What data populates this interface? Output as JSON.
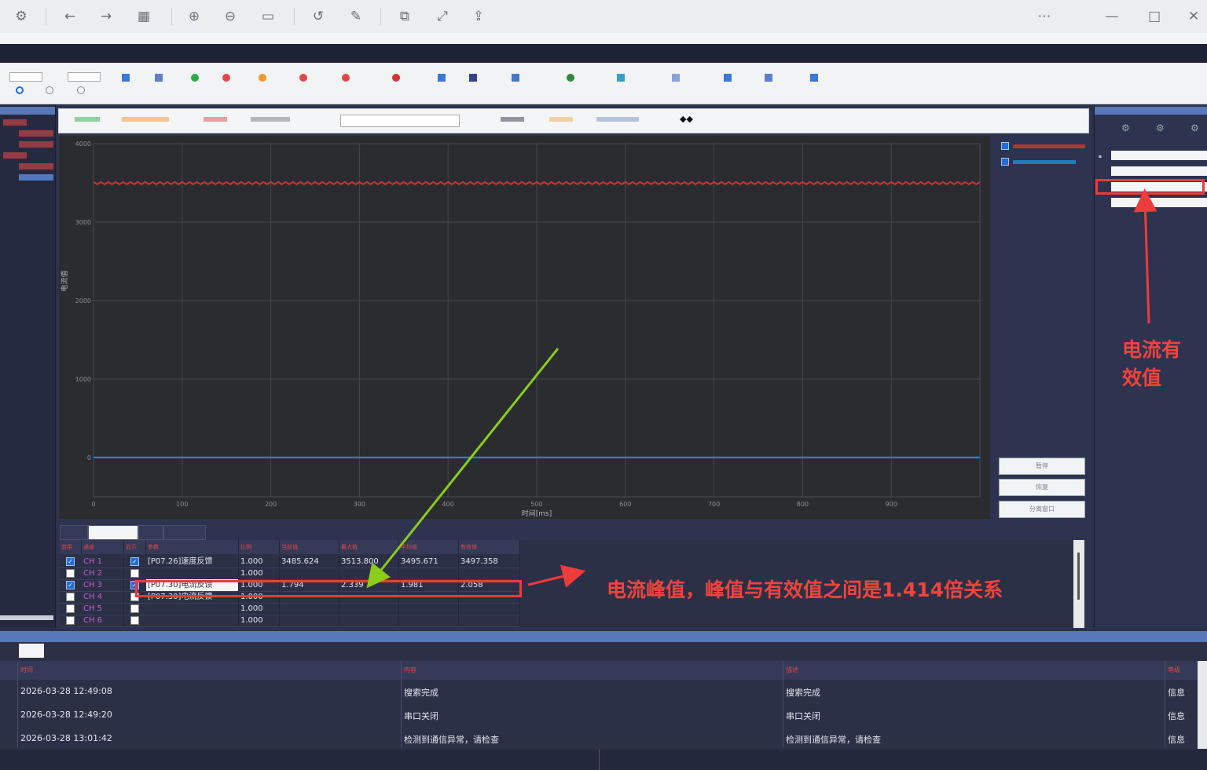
{
  "chart_data": {
    "type": "line",
    "xlabel": "时间[ms]",
    "ylabel": "电流值",
    "x_ticks": [
      "0",
      "100",
      "200",
      "300",
      "400",
      "500",
      "600",
      "700",
      "800",
      "900"
    ],
    "y_ticks": [
      "4000",
      "3000",
      "2000",
      "1000",
      "0"
    ],
    "xlim": [
      0,
      1000
    ],
    "ylim": [
      -500,
      4000
    ],
    "series": [
      {
        "color": "#d23434",
        "x": [
          0,
          1000
        ],
        "y": [
          3497,
          3497
        ]
      },
      {
        "color": "#1f8fd6",
        "x": [
          0,
          1000
        ],
        "y": [
          2,
          2
        ]
      }
    ],
    "grid": true
  },
  "table": {
    "headers": [
      "启用",
      "通道",
      "显示",
      "参数",
      "比例",
      "当前值",
      "最大值",
      "平均值",
      "有效值"
    ],
    "rows": [
      {
        "enable": true,
        "channel": "CH 1",
        "show": true,
        "param": "[P07.26]速度反馈",
        "ratio": "1.000",
        "current": "3485.624",
        "max": "3513.800",
        "avg": "3495.671",
        "rms": "3497.358"
      },
      {
        "enable": false,
        "channel": "CH 2",
        "show": false,
        "param": "",
        "ratio": "1.000",
        "current": "",
        "max": "",
        "avg": "",
        "rms": ""
      },
      {
        "enable": true,
        "channel": "CH 3",
        "show": true,
        "param": "[P07.30]电流反馈",
        "ratio": "1.000",
        "current": "1.794",
        "max": "2.339",
        "avg": "1.981",
        "rms": "2.058"
      },
      {
        "enable": false,
        "channel": "CH 4",
        "show": false,
        "param": "[P07.30]电流反馈",
        "ratio": "1.000",
        "current": "",
        "max": "",
        "avg": "",
        "rms": ""
      },
      {
        "enable": false,
        "channel": "CH 5",
        "show": false,
        "param": "",
        "ratio": "1.000",
        "current": "",
        "max": "",
        "avg": "",
        "rms": ""
      },
      {
        "enable": false,
        "channel": "CH 6",
        "show": false,
        "param": "",
        "ratio": "1.000",
        "current": "",
        "max": "",
        "avg": "",
        "rms": ""
      }
    ]
  },
  "side_buttons": [
    "暂停",
    "恢复",
    "分离窗口"
  ],
  "log": {
    "headers": [
      "时间",
      "内容",
      "描述",
      "等级"
    ],
    "rows": [
      {
        "time": "2026-03-28 12:49:08",
        "content": "搜索完成",
        "desc": "搜索完成",
        "level": "信息"
      },
      {
        "time": "2026-03-28 12:49:20",
        "content": "串口关闭",
        "desc": "串口关闭",
        "level": "信息"
      },
      {
        "time": "2026-03-28 13:01:42",
        "content": "检测到通信异常，请检查",
        "desc": "检测到通信异常，请检查",
        "level": "信息"
      }
    ]
  },
  "annotations": {
    "rms_label_line1": "电流有",
    "rms_label_line2": "效值",
    "peak_label": "电流峰值，峰值与有效值之间是1.414倍关系"
  },
  "colors": {
    "accent_red": "#ee3b3b",
    "arrow_green": "#8ccc1a"
  }
}
